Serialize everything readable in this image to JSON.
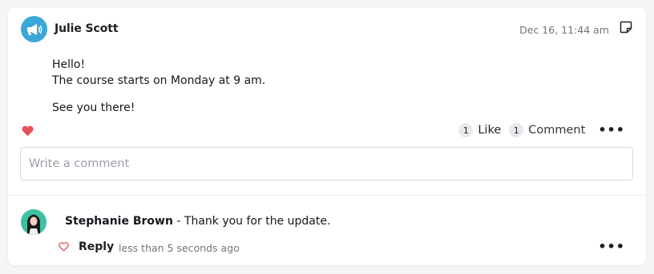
{
  "post": {
    "author": "Julie Scott",
    "timestamp": "Dec 16, 11:44 am",
    "body_lines": [
      "Hello!",
      "The course starts on Monday at 9 am.",
      "See you there!"
    ],
    "likes_count": "1",
    "like_label": "Like",
    "comments_count": "1",
    "comment_label": "Comment",
    "more": "•••"
  },
  "comment_input": {
    "placeholder": "Write a comment"
  },
  "comment": {
    "author": "Stephanie Brown",
    "separator": " - ",
    "text": "Thank you for the update.",
    "reply_label": "Reply",
    "time": "less than 5 seconds ago",
    "more": "•••"
  },
  "colors": {
    "announce_avatar": "#3aa7d8",
    "heart": "#e8505b",
    "commenter_avatar_bg": "#3cc2a2"
  },
  "icons": {
    "author_avatar": "megaphone-icon",
    "note": "note-icon",
    "liked": "heart-filled-icon",
    "comment_like": "heart-outline-icon"
  }
}
